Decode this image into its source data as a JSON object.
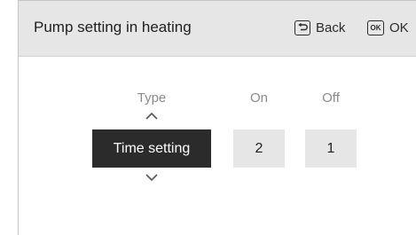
{
  "header": {
    "title": "Pump setting in heating",
    "back_label": "Back",
    "ok_icon_text": "OK",
    "ok_label": "OK"
  },
  "columns": {
    "type_label": "Type",
    "on_label": "On",
    "off_label": "Off"
  },
  "values": {
    "type_value": "Time setting",
    "on_value": "2",
    "off_value": "1"
  },
  "icons": {
    "back": "back-return-icon",
    "ok": "ok-key-icon",
    "up": "chevron-up-icon",
    "down": "chevron-down-icon"
  },
  "colors": {
    "header_bg": "#e6e6e6",
    "selected_bg": "#2b2b2b",
    "value_bg": "#e6e6e6",
    "label_gray": "#8a8a8a"
  }
}
